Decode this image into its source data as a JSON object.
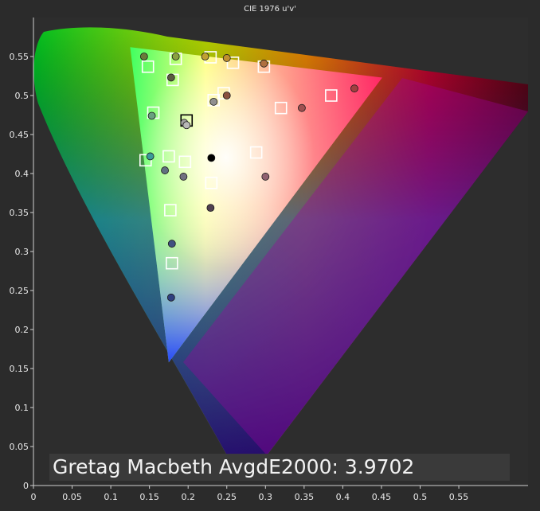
{
  "chart_data": {
    "type": "scatter",
    "title": "CIE 1976 u'v'",
    "xlabel": "",
    "ylabel": "",
    "xlim": [
      0,
      0.6
    ],
    "ylim": [
      0,
      0.6
    ],
    "x_ticks": [
      "0",
      "0.05",
      "0.1",
      "0.15",
      "0.2",
      "0.25",
      "0.3",
      "0.35",
      "0.4",
      "0.45",
      "0.5",
      "0.55"
    ],
    "y_ticks": [
      "0",
      "0.05",
      "0.1",
      "0.15",
      "0.2",
      "0.25",
      "0.3",
      "0.35",
      "0.4",
      "0.45",
      "0.5",
      "0.55"
    ],
    "gamut_triangle": [
      [
        0.125,
        0.562
      ],
      [
        0.451,
        0.523
      ],
      [
        0.175,
        0.158
      ]
    ],
    "white_point": [
      0.198,
      0.468
    ],
    "target_squares": [
      [
        0.148,
        0.537
      ],
      [
        0.184,
        0.547
      ],
      [
        0.229,
        0.549
      ],
      [
        0.258,
        0.542
      ],
      [
        0.298,
        0.537
      ],
      [
        0.18,
        0.52
      ],
      [
        0.246,
        0.503
      ],
      [
        0.233,
        0.494
      ],
      [
        0.155,
        0.478
      ],
      [
        0.32,
        0.484
      ],
      [
        0.385,
        0.5
      ],
      [
        0.198,
        0.468
      ],
      [
        0.145,
        0.417
      ],
      [
        0.175,
        0.422
      ],
      [
        0.196,
        0.415
      ],
      [
        0.288,
        0.427
      ],
      [
        0.23,
        0.388
      ],
      [
        0.177,
        0.353
      ],
      [
        0.179,
        0.285
      ]
    ],
    "measured_points": [
      {
        "u": 0.143,
        "v": 0.55,
        "color": "#6a7a3a"
      },
      {
        "u": 0.184,
        "v": 0.55,
        "color": "#8aa040"
      },
      {
        "u": 0.222,
        "v": 0.55,
        "color": "#c0a030"
      },
      {
        "u": 0.25,
        "v": 0.548,
        "color": "#c09030"
      },
      {
        "u": 0.298,
        "v": 0.541,
        "color": "#b07040"
      },
      {
        "u": 0.178,
        "v": 0.523,
        "color": "#5a5a40"
      },
      {
        "u": 0.25,
        "v": 0.5,
        "color": "#8a5040"
      },
      {
        "u": 0.415,
        "v": 0.509,
        "color": "#a04040"
      },
      {
        "u": 0.347,
        "v": 0.484,
        "color": "#a05050"
      },
      {
        "u": 0.233,
        "v": 0.492,
        "color": "#909090"
      },
      {
        "u": 0.153,
        "v": 0.474,
        "color": "#6aa080"
      },
      {
        "u": 0.195,
        "v": 0.465,
        "color": "#a0a0a0"
      },
      {
        "u": 0.198,
        "v": 0.462,
        "color": "#b8b8b8"
      },
      {
        "u": 0.23,
        "v": 0.42,
        "color": "#000000"
      },
      {
        "u": 0.151,
        "v": 0.422,
        "color": "#3a9a9a"
      },
      {
        "u": 0.17,
        "v": 0.404,
        "color": "#607080"
      },
      {
        "u": 0.194,
        "v": 0.396,
        "color": "#707080"
      },
      {
        "u": 0.3,
        "v": 0.396,
        "color": "#906070"
      },
      {
        "u": 0.229,
        "v": 0.356,
        "color": "#504050"
      },
      {
        "u": 0.179,
        "v": 0.31,
        "color": "#405080"
      },
      {
        "u": 0.178,
        "v": 0.241,
        "color": "#304080"
      }
    ],
    "annotation": "Gretag Macbeth AvgdE2000: 3.9702"
  }
}
